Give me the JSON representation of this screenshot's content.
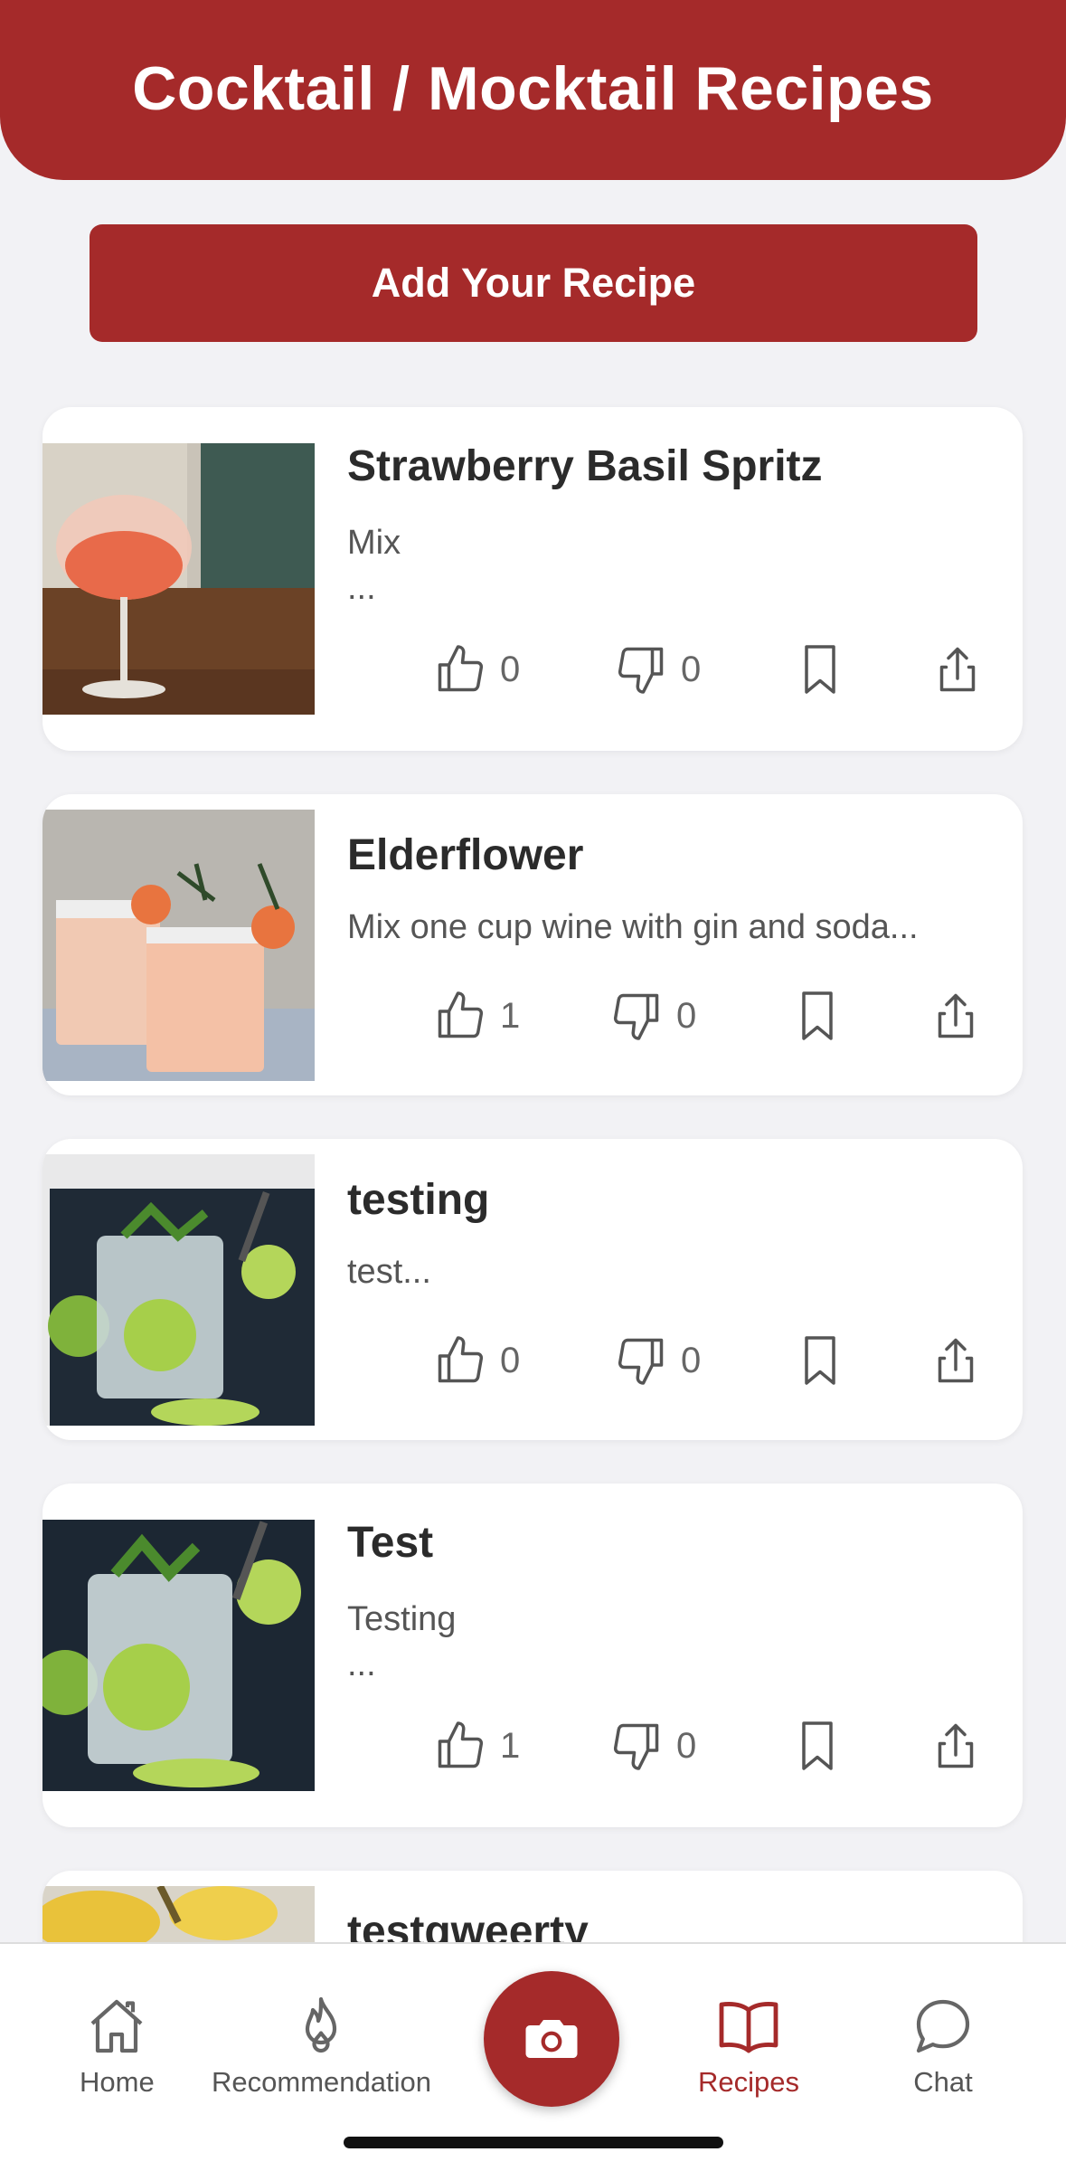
{
  "header": {
    "title": "Cocktail / Mocktail Recipes"
  },
  "add_button": {
    "label": "Add Your Recipe"
  },
  "recipes": [
    {
      "title": "Strawberry Basil Spritz",
      "description": "Mix\n...",
      "likes": "0",
      "dislikes": "0",
      "image": "pink-spritz-wine-glass"
    },
    {
      "title": "Elderflower",
      "description": "Mix one cup wine with gin and soda...",
      "likes": "1",
      "dislikes": "0",
      "image": "grapefruit-rosemary-cocktails"
    },
    {
      "title": "testing",
      "description": "test...",
      "likes": "0",
      "dislikes": "0",
      "image": "mojito-screenshot"
    },
    {
      "title": "Test",
      "description": "Testing\n...",
      "likes": "1",
      "dislikes": "0",
      "image": "mojito-lime-mint"
    },
    {
      "title": "testqweerty",
      "description": "",
      "likes": "",
      "dislikes": "",
      "image": "pineapple"
    }
  ],
  "tabbar": {
    "items": [
      {
        "label": "Home",
        "icon": "home-icon"
      },
      {
        "label": "Recommendation",
        "icon": "flame-icon"
      },
      {
        "label": "",
        "icon": "camera-icon"
      },
      {
        "label": "Recipes",
        "icon": "book-icon",
        "active": true
      },
      {
        "label": "Chat",
        "icon": "chat-bubble-icon"
      }
    ]
  },
  "colors": {
    "accent": "#a52a2a",
    "background": "#f2f2f5",
    "card": "#ffffff"
  }
}
